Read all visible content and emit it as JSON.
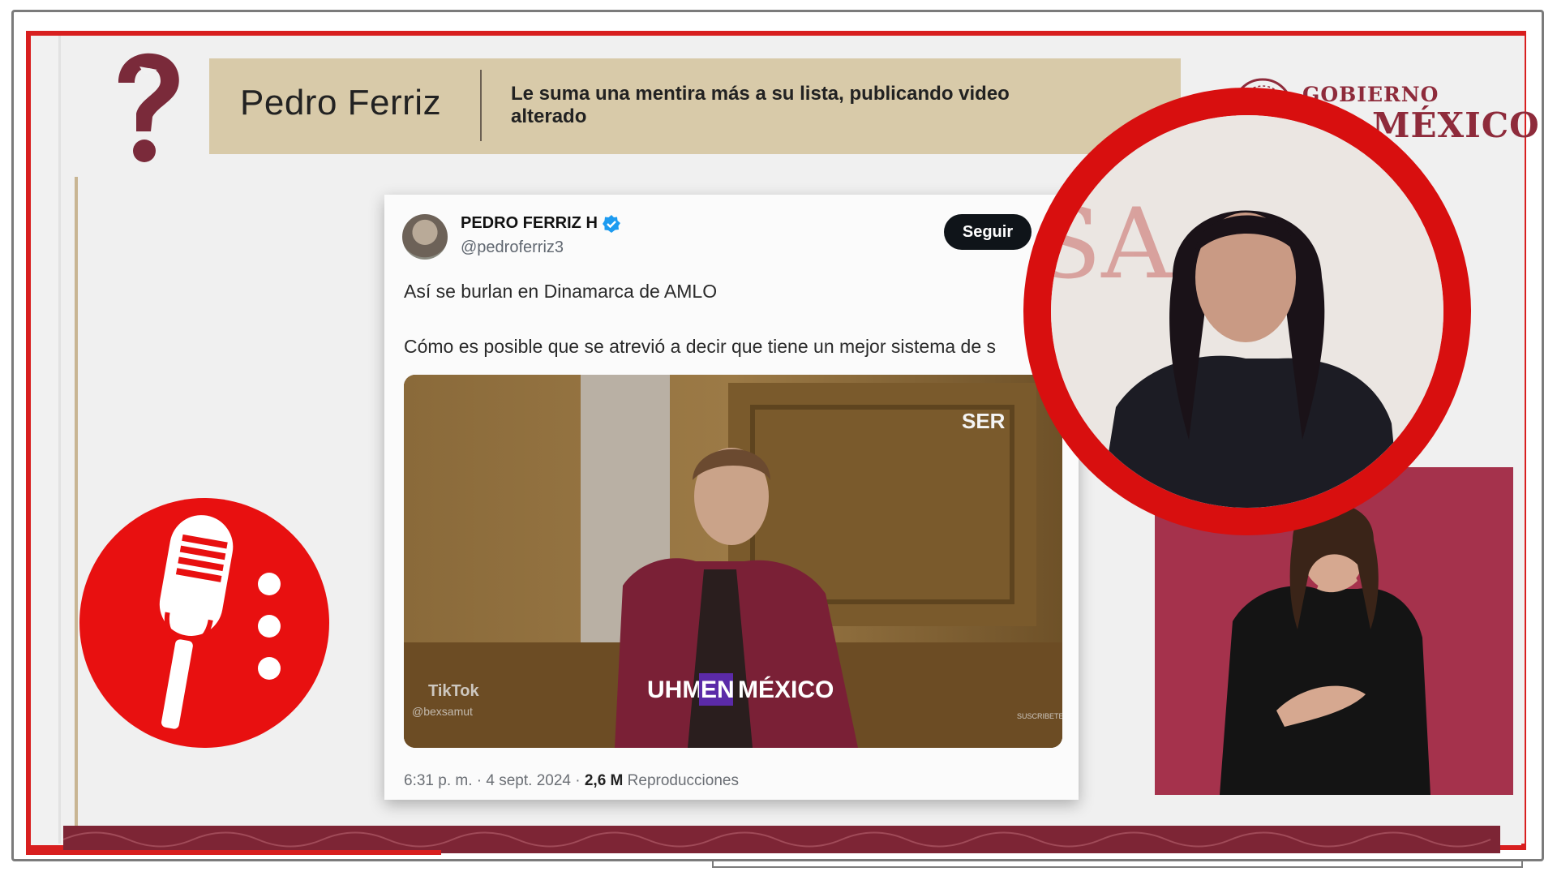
{
  "header": {
    "name": "Pedro Ferriz",
    "description": "Le suma una mentira más a su lista, publicando video alterado"
  },
  "government_logo": {
    "line1": "GOBIERNO DE",
    "line2": "MÉXICO",
    "color": "#8e2b3b"
  },
  "tweet": {
    "display_name": "PEDRO FERRIZ H",
    "handle": "@pedroferriz3",
    "follow_label": "Seguir",
    "text_line1": "Así se burlan en Dinamarca de AMLO",
    "text_line2": "Cómo es posible que se atrevió a decir que tiene un mejor sistema de s",
    "video": {
      "channel_logo": "SER",
      "caption_pre": "UHM",
      "caption_highlight": "EN",
      "caption_post": "MÉXICO",
      "watermark": "TikTok",
      "watermark_user": "@bexsamut",
      "corner_label": "SUSCRIBETE"
    },
    "timestamp": "6:31 p. m. · 4 sept. 2024 ·",
    "views_count": "2,6 M",
    "views_label": "Reproducciones"
  },
  "icons": {
    "question": "question-mark-bird-icon",
    "microphone": "microphone-icon",
    "verified": "verified-badge-icon"
  },
  "colors": {
    "frame_red": "#d81f1f",
    "header_bar": "#d8caa9",
    "maroon": "#7d2535",
    "verified_blue": "#1d9bf0"
  }
}
